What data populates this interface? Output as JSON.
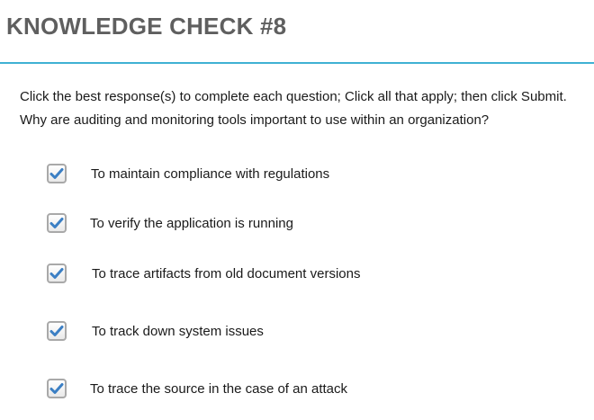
{
  "header": {
    "title": "KNOWLEDGE CHECK #8"
  },
  "instructions": "Click the best response(s) to complete each question; Click all that apply; then click Submit.",
  "question": "Why are auditing and monitoring tools important to use within an organization?",
  "options": [
    {
      "label": "To maintain compliance with regulations",
      "checked": true
    },
    {
      "label": "To verify the application is running",
      "checked": true
    },
    {
      "label": "To trace artifacts from old document versions",
      "checked": true
    },
    {
      "label": "To track down system issues",
      "checked": true
    },
    {
      "label": "To trace the source in the case of an attack",
      "checked": true
    }
  ],
  "colors": {
    "accent_line": "#3fb1d3",
    "checkmark": "#3b7fc4",
    "title": "#5f5f5f"
  }
}
